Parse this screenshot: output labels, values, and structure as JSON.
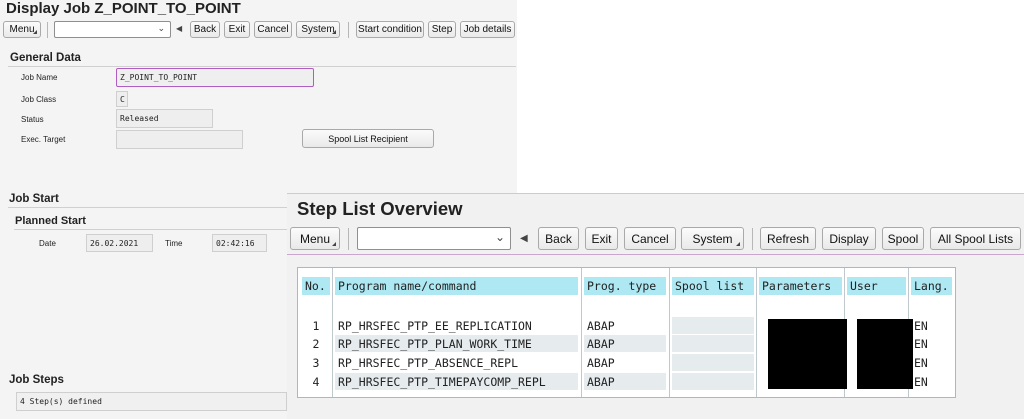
{
  "job_window": {
    "title": "Display Job Z_POINT_TO_POINT",
    "toolbar": {
      "menu": "Menu",
      "command_value": "",
      "back": "Back",
      "exit": "Exit",
      "cancel": "Cancel",
      "system": "System",
      "start_condition": "Start condition",
      "step": "Step",
      "job_details": "Job details"
    },
    "general_data": {
      "heading": "General Data",
      "job_name_label": "Job Name",
      "job_name_value": "Z_POINT_TO_POINT",
      "job_class_label": "Job Class",
      "job_class_value": "C",
      "status_label": "Status",
      "status_value": "Released",
      "exec_target_label": "Exec. Target",
      "exec_target_value": "",
      "spool_button": "Spool List Recipient"
    },
    "job_start": {
      "heading": "Job Start",
      "planned_heading": "Planned Start",
      "date_label": "Date",
      "date_value": "26.02.2021",
      "time_label": "Time",
      "time_value": "02:42:16"
    },
    "job_steps": {
      "heading": "Job Steps",
      "summary": "4 Step(s) defined"
    }
  },
  "step_window": {
    "title": "Step List Overview",
    "toolbar": {
      "menu": "Menu",
      "command_value": "",
      "back": "Back",
      "exit": "Exit",
      "cancel": "Cancel",
      "system": "System",
      "refresh": "Refresh",
      "display": "Display",
      "spool": "Spool",
      "all_spool_lists": "All Spool Lists"
    },
    "columns": [
      "No.",
      "Program name/command",
      "Prog. type",
      "Spool list",
      "Parameters",
      "User",
      "Lang."
    ],
    "rows": [
      {
        "no": "1",
        "program": "RP_HRSFEC_PTP_EE_REPLICATION",
        "type": "ABAP",
        "spool": "",
        "lang": "EN"
      },
      {
        "no": "2",
        "program": "RP_HRSFEC_PTP_PLAN_WORK_TIME",
        "type": "ABAP",
        "spool": "",
        "lang": "EN"
      },
      {
        "no": "3",
        "program": "RP_HRSFEC_PTP_ABSENCE_REPL",
        "type": "ABAP",
        "spool": "",
        "lang": "EN"
      },
      {
        "no": "4",
        "program": "RP_HRSFEC_PTP_TIMEPAYCOMP_REPL",
        "type": "ABAP",
        "spool": "",
        "lang": "EN"
      }
    ]
  }
}
